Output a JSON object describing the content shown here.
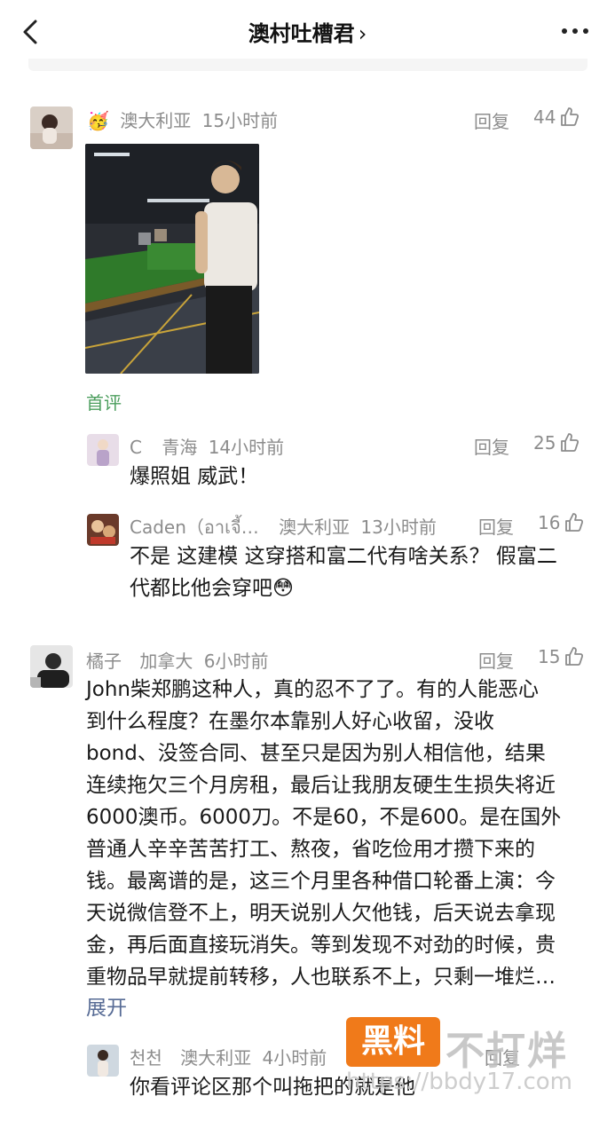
{
  "header": {
    "title": "澳村吐槽君",
    "chevron": "›"
  },
  "comments": [
    {
      "emoji": "🥳",
      "location": "澳大利亚",
      "time": "15小时前",
      "reply_label": "回复",
      "likes": "44",
      "badge": "首评"
    },
    {
      "name": "C",
      "location": "青海",
      "time": "14小时前",
      "reply_label": "回复",
      "likes": "25",
      "text": "爆照姐 威武！"
    },
    {
      "name": "Caden（อาเจี้…",
      "location": "澳大利亚",
      "time": "13小时前",
      "reply_label": "回复",
      "likes": "16",
      "text_line1": "不是 这建模 这穿搭和富二代有啥关系？ 假富二",
      "text_line2": "代都比他会穿吧😳"
    },
    {
      "name": "橘子",
      "location": "加拿大",
      "time": "6小时前",
      "reply_label": "回复",
      "likes": "15",
      "lines": [
        "John柴郑鹏这种人，真的忍不了了。有的人能恶心",
        "到什么程度？在墨尔本靠别人好心收留，没收",
        "bond、没签合同、甚至只是因为别人相信他，结果",
        "连续拖欠三个月房租，最后让我朋友硬生生损失将近",
        "6000澳币。6000刀。不是60，不是600。是在国外",
        "普通人辛辛苦苦打工、熬夜，省吃俭用才攒下来的",
        "钱。最离谱的是，这三个月里各种借口轮番上演：今",
        "天说微信登不上，明天说别人欠他钱，后天说去拿现",
        "金，再后面直接玩消失。等到发现不对劲的时候，贵",
        "重物品早就提前转移，人也联系不上，只剩一堆烂…"
      ],
      "expand_label": "展开"
    },
    {
      "name": "천천",
      "location": "澳大利亚",
      "time": "4小时前",
      "reply_label": "回复",
      "text": "你看评论区那个叫拖把的就是他"
    }
  ],
  "watermark": {
    "badge": "黑料",
    "text": "不打烊",
    "url": "https://bbdy17.com"
  },
  "icons": {
    "back": "chevron-left-icon",
    "more": "more-dots-icon",
    "like": "thumbs-up-icon"
  }
}
